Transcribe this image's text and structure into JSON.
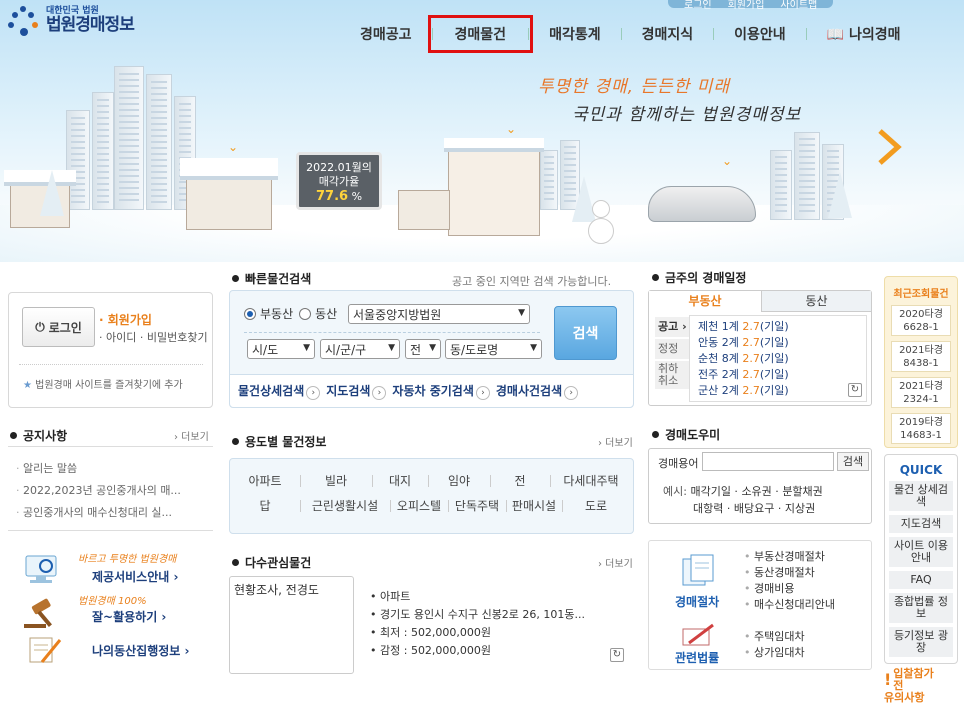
{
  "header": {
    "logo_small": "대한민국 법원",
    "logo_big": "법원경매정보",
    "top_links": [
      "로그인",
      "회원가입",
      "사이트맵"
    ],
    "nav": [
      "경매공고",
      "경매물건",
      "매각통계",
      "경매지식",
      "이용안내",
      "나의경매"
    ]
  },
  "banner": {
    "slogan1": "투명한 경매, 든든한 미래",
    "slogan2": "국민과 함께하는 법원경매정보",
    "sign_line1": "2022.01월의",
    "sign_line2": "매각가율",
    "sign_rate": "77.6",
    "sign_unit": "%"
  },
  "login": {
    "button": "로그인",
    "join": "회원가입",
    "find": "아이디 · 비밀번호찾기",
    "favorite": "법원경매 사이트를 즐겨찾기에 추가"
  },
  "notice": {
    "title": "공지사항",
    "more": "› 더보기",
    "items": [
      "알리는 말씀",
      "2022,2023년 공인중개사의 매...",
      "공인중개사의 매수신청대리 실..."
    ]
  },
  "services": [
    {
      "script": "바르고 투명한 법원경매",
      "label": "제공서비스안내 ›"
    },
    {
      "script": "법원경매 100%",
      "label": "잘~활용하기 ›"
    },
    {
      "script": "",
      "label": "나의동산집행정보 ›"
    }
  ],
  "quick_search": {
    "title": "빠른물건검색",
    "hint": "공고 중인 지역만 검색 가능합니다.",
    "radio1": "부동산",
    "radio2": "동산",
    "court": "서울중앙지방법원",
    "sido": "시/도",
    "sigungu": "시/군/구",
    "jeon": "전",
    "dong": "동/도로명",
    "search": "검색",
    "links": [
      "물건상세검색",
      "지도검색",
      "자동차 중기검색",
      "경매사건검색"
    ]
  },
  "uses": {
    "title": "용도별 물건정보",
    "more": "› 더보기",
    "row1": [
      "아파트",
      "빌라",
      "대지",
      "임야",
      "전",
      "다세대주택"
    ],
    "row2": [
      "답",
      "근린생활시설",
      "오피스텔",
      "단독주택",
      "판매시설",
      "도로"
    ]
  },
  "interest": {
    "title": "다수관심물건",
    "more": "› 더보기",
    "box": "현황조사, 전경도",
    "items": [
      "아파트",
      "경기도 용인시 수지구 신봉2로 26, 101동...",
      "최저 : 502,000,000원",
      "감정 : 502,000,000원"
    ]
  },
  "schedule": {
    "title": "금주의 경매일정",
    "tab_on": "부동산",
    "tab_off": "동산",
    "side": [
      "공고 ›",
      "정정",
      "취하 취소"
    ],
    "rows": [
      {
        "court": "제천 1계",
        "date": "2.7",
        "note": "(기일)"
      },
      {
        "court": "안동 2계",
        "date": "2.7",
        "note": "(기일)"
      },
      {
        "court": "순천 8계",
        "date": "2.7",
        "note": "(기일)"
      },
      {
        "court": "전주 2계",
        "date": "2.7",
        "note": "(기일)"
      },
      {
        "court": "군산 2계",
        "date": "2.7",
        "note": "(기일)"
      }
    ]
  },
  "helper": {
    "title": "경매도우미",
    "label": "경매용어",
    "button": "검색",
    "ex_label": "예시:",
    "ex1": [
      "매각기일",
      "소유권",
      "분할채권"
    ],
    "ex2": [
      "대항력",
      "배당요구",
      "지상권"
    ]
  },
  "guide": {
    "cap1": "경매절차",
    "list1": [
      "부동산경매절차",
      "동산경매절차",
      "경매비용",
      "매수신청대리안내"
    ],
    "cap2": "관련법률",
    "list2": [
      "주택임대차",
      "상가임대차"
    ]
  },
  "recent": {
    "title": "최근조회물건",
    "items": [
      [
        "2020타경",
        "6628-1"
      ],
      [
        "2021타경",
        "8438-1"
      ],
      [
        "2021타경",
        "2324-1"
      ],
      [
        "2019타경",
        "14683-1"
      ]
    ]
  },
  "quick": {
    "title": "QUICK",
    "items": [
      "물건 상세검색",
      "지도검색",
      "사이트 이용안내",
      "FAQ",
      "종합법률 정보",
      "등기정보 광장"
    ]
  },
  "caution": {
    "line1": "입찰참가전",
    "line2": "유의사항"
  },
  "colors": {
    "accent": "#e9801c",
    "brand": "#1d3f7c",
    "highlight_box": "#e01010"
  }
}
